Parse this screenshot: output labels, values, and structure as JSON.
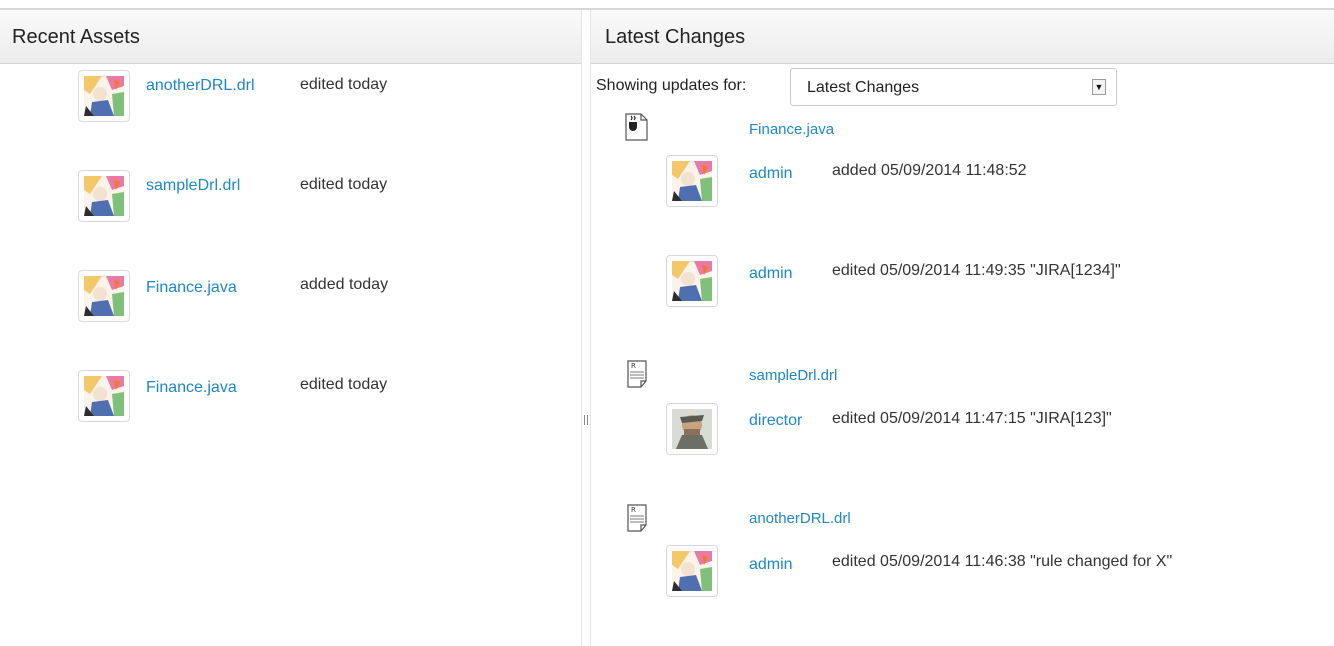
{
  "recent_assets": {
    "title": "Recent Assets",
    "items": [
      {
        "name": "anotherDRL.drl",
        "status": "edited today"
      },
      {
        "name": "sampleDrl.drl",
        "status": "edited today"
      },
      {
        "name": "Finance.java",
        "status": "added today"
      },
      {
        "name": "Finance.java",
        "status": "edited today"
      }
    ]
  },
  "latest_changes": {
    "title": "Latest Changes",
    "filter_label": "Showing updates for:",
    "filter_value": "Latest Changes",
    "groups": [
      {
        "file": "Finance.java",
        "icon": "java-file-icon",
        "entries": [
          {
            "user": "admin",
            "action": "added 05/09/2014 11:48:52"
          },
          {
            "user": "admin",
            "action": "edited 05/09/2014 11:49:35 \"JIRA[1234]\""
          }
        ]
      },
      {
        "file": "sampleDrl.drl",
        "icon": "rule-file-icon",
        "entries": [
          {
            "user": "director",
            "action": "edited 05/09/2014 11:47:15 \"JIRA[123]\""
          }
        ]
      },
      {
        "file": "anotherDRL.drl",
        "icon": "rule-file-icon",
        "entries": [
          {
            "user": "admin",
            "action": "edited 05/09/2014 11:46:38 \"rule changed for X\""
          }
        ]
      }
    ]
  },
  "colors": {
    "link": "#1d87c9",
    "header_bg": "#ececec"
  }
}
